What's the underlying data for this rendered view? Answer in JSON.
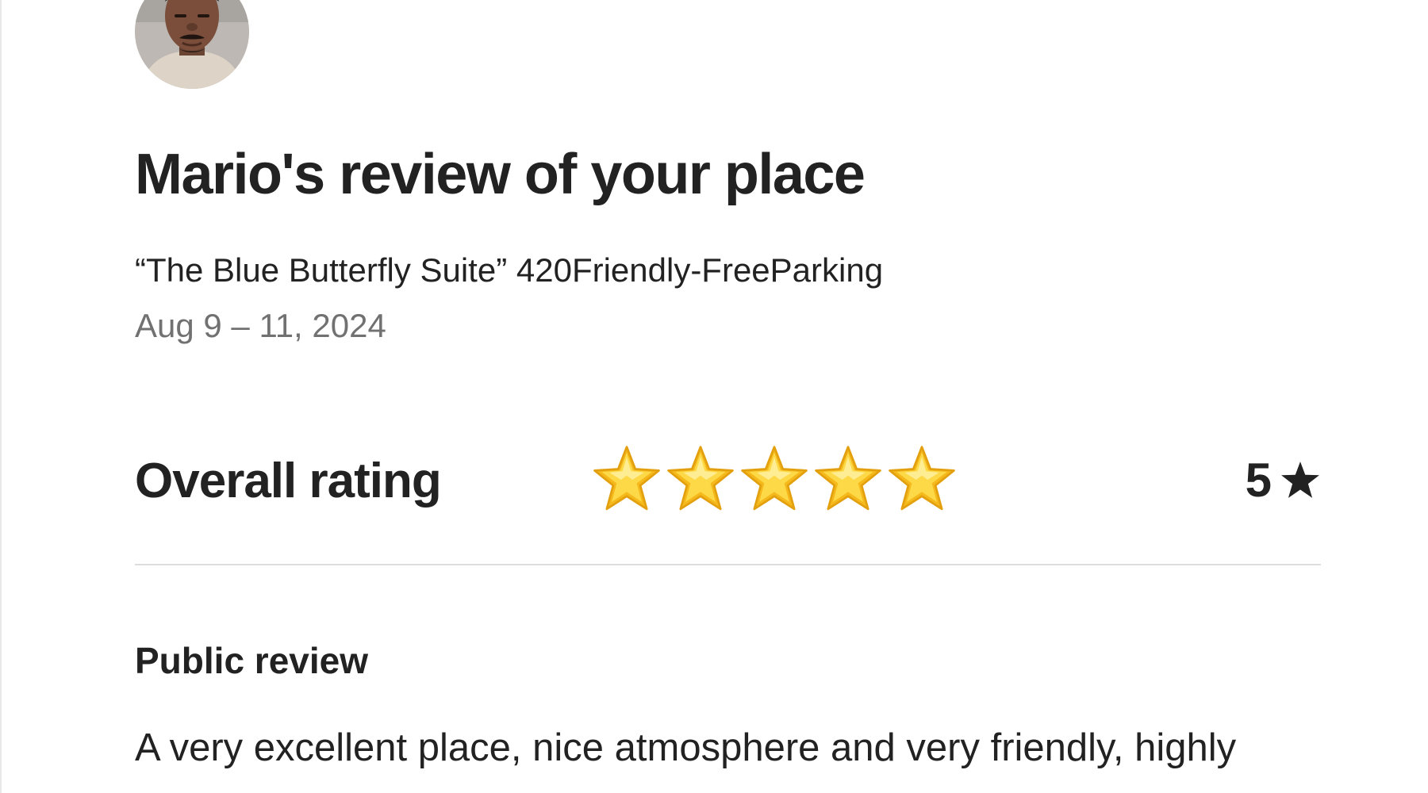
{
  "review": {
    "title": "Mario's review of your place",
    "listing_name": "“The Blue Butterfly Suite” 420Friendly-FreeParking",
    "dates": "Aug 9 – 11, 2024"
  },
  "rating": {
    "label": "Overall rating",
    "value": 5,
    "max": 5,
    "value_text": "5"
  },
  "public_review": {
    "heading": "Public review",
    "text": "A very excellent place, nice atmosphere and very friendly, highly"
  },
  "icons": {
    "avatar": "reviewer-avatar-photo",
    "rating_star": "star-emoji-icon",
    "rating_value_star": "black-star-icon"
  },
  "colors": {
    "text_primary": "#222222",
    "text_secondary": "#717171",
    "divider": "#dddddd",
    "star_gold": "#f7c325"
  }
}
